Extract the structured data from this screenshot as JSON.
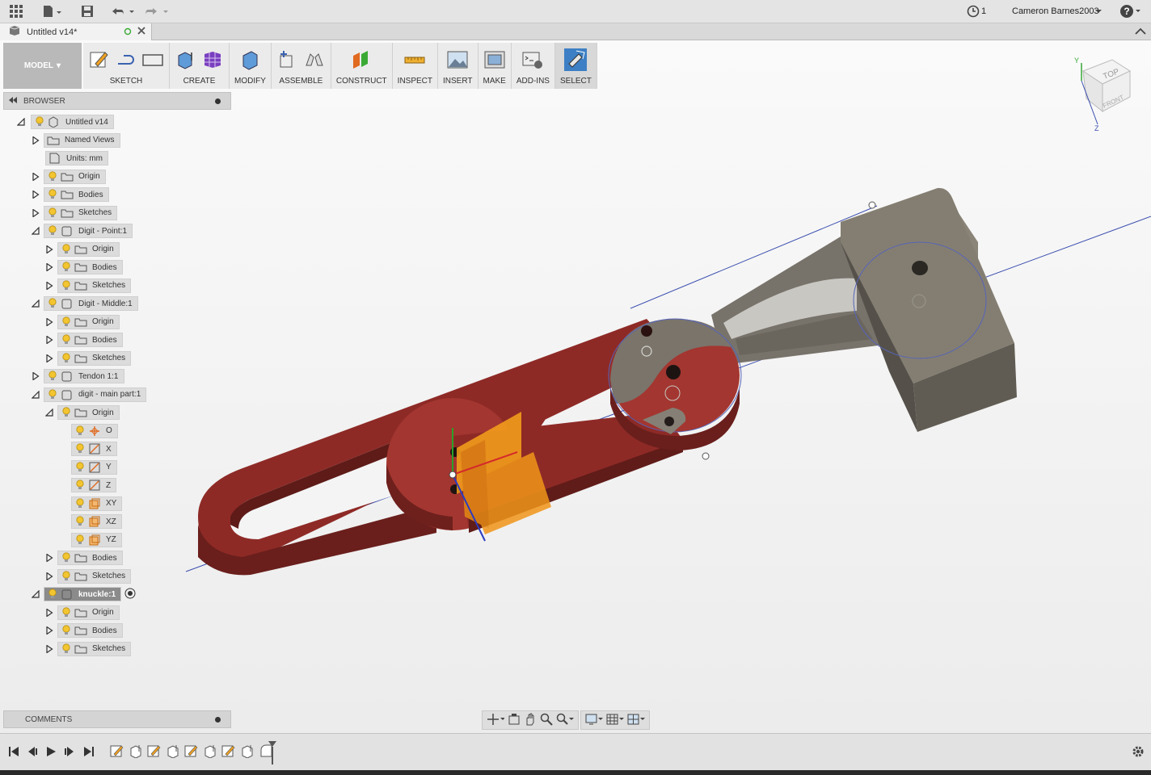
{
  "app": {
    "document_title": "Untitled v14*",
    "jobs_count": "1",
    "user_name": "Cameron Barnes2003",
    "help_label": "?"
  },
  "toolbar": {
    "mode_label": "MODEL",
    "groups": [
      {
        "label": "SKETCH"
      },
      {
        "label": "CREATE"
      },
      {
        "label": "MODIFY"
      },
      {
        "label": "ASSEMBLE"
      },
      {
        "label": "CONSTRUCT"
      },
      {
        "label": "INSPECT"
      },
      {
        "label": "INSERT"
      },
      {
        "label": "MAKE"
      },
      {
        "label": "ADD-INS"
      },
      {
        "label": "SELECT"
      }
    ]
  },
  "browser": {
    "title": "BROWSER",
    "items": [
      {
        "label": "Untitled v14"
      },
      {
        "label": "Named Views"
      },
      {
        "label": "Units: mm"
      },
      {
        "label": "Origin"
      },
      {
        "label": "Bodies"
      },
      {
        "label": "Sketches"
      },
      {
        "label": "Digit - Point:1"
      },
      {
        "label": "Origin"
      },
      {
        "label": "Bodies"
      },
      {
        "label": "Sketches"
      },
      {
        "label": "Digit - Middle:1"
      },
      {
        "label": "Origin"
      },
      {
        "label": "Bodies"
      },
      {
        "label": "Sketches"
      },
      {
        "label": "Tendon 1:1"
      },
      {
        "label": "digit - main part:1"
      },
      {
        "label": "Origin"
      },
      {
        "label": "O"
      },
      {
        "label": "X"
      },
      {
        "label": "Y"
      },
      {
        "label": "Z"
      },
      {
        "label": "XY"
      },
      {
        "label": "XZ"
      },
      {
        "label": "YZ"
      },
      {
        "label": "Bodies"
      },
      {
        "label": "Sketches"
      },
      {
        "label": "knuckle:1"
      },
      {
        "label": "Origin"
      },
      {
        "label": "Bodies"
      },
      {
        "label": "Sketches"
      }
    ]
  },
  "comments": {
    "title": "COMMENTS"
  },
  "viewcube": {
    "top_label": "TOP",
    "front_label": "FRONT",
    "axis_y": "Y",
    "axis_z": "Z"
  },
  "colors": {
    "part_red": "#8e2a26",
    "part_grey": "#6f6a5f",
    "plane_orange": "#f7a21b",
    "axis_blue": "#3b4fb0"
  }
}
